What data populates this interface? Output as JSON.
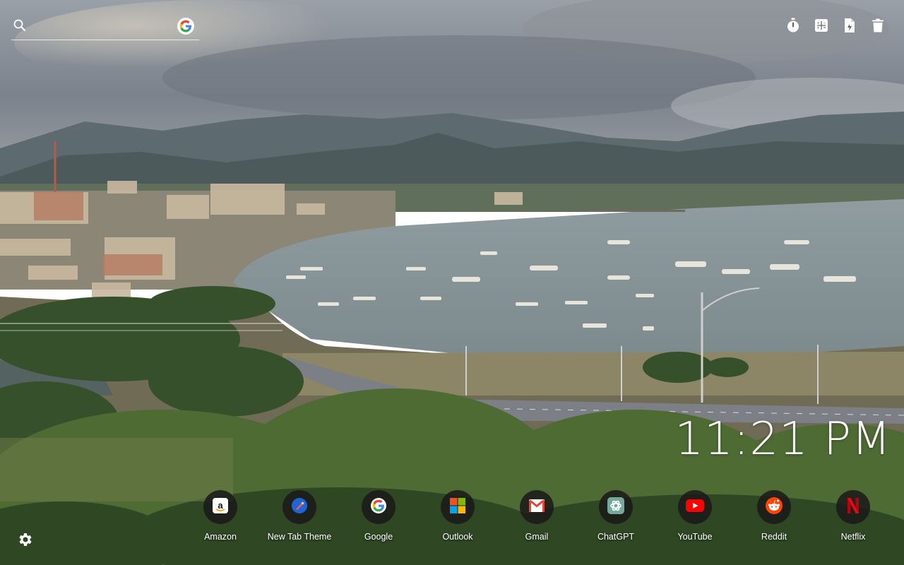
{
  "search": {
    "placeholder": ""
  },
  "tools": [
    {
      "icon": "timer-icon"
    },
    {
      "icon": "calculator-icon"
    },
    {
      "icon": "document-icon"
    },
    {
      "icon": "trash-icon"
    }
  ],
  "clock": {
    "time": "11:21 PM"
  },
  "shortcuts": [
    {
      "label": "Amazon",
      "icon": "amazon-icon"
    },
    {
      "label": "New Tab Theme",
      "icon": "new-tab-theme-icon"
    },
    {
      "label": "Google",
      "icon": "google-icon"
    },
    {
      "label": "Outlook",
      "icon": "microsoft-icon"
    },
    {
      "label": "Gmail",
      "icon": "gmail-icon"
    },
    {
      "label": "ChatGPT",
      "icon": "chatgpt-icon"
    },
    {
      "label": "YouTube",
      "icon": "youtube-icon"
    },
    {
      "label": "Reddit",
      "icon": "reddit-icon"
    },
    {
      "label": "Netflix",
      "icon": "netflix-icon"
    }
  ],
  "colors": {
    "google_blue": "#4285F4",
    "google_red": "#EA4335",
    "google_yellow": "#FBBC05",
    "google_green": "#34A853",
    "youtube_red": "#FF0000",
    "reddit_orange": "#FF4500",
    "netflix_red": "#E50914",
    "chatgpt_teal": "#74AA9C"
  }
}
